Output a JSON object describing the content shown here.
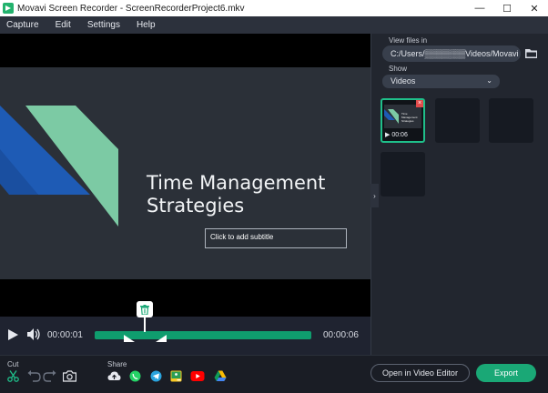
{
  "window": {
    "title": "Movavi Screen Recorder - ScreenRecorderProject6.mkv",
    "minimize": "—",
    "maximize": "☐",
    "close": "✕"
  },
  "menu": [
    "Capture",
    "Edit",
    "Settings",
    "Help"
  ],
  "preview": {
    "slide_title_line1": "Time Management",
    "slide_title_line2": "Strategies",
    "subtitle_placeholder": "Click to add subtitle"
  },
  "player": {
    "current_time": "00:00:01",
    "total_time": "00:00:06",
    "position": 0.23
  },
  "sidebar": {
    "view_files_label": "View files in",
    "path": "C:/Users/▒▒▒▒▒▒▒Videos/Movavi",
    "show_label": "Show",
    "show_value": "Videos",
    "thumbnails": [
      {
        "duration": "00:06",
        "caption": "Time Management Strategies",
        "active": true
      },
      {
        "duration": "",
        "active": false
      },
      {
        "duration": "",
        "active": false
      },
      {
        "duration": "",
        "active": false
      }
    ]
  },
  "bottom": {
    "cut_label": "Cut",
    "share_label": "Share",
    "open_editor": "Open in Video Editor",
    "export": "Export"
  },
  "colors": {
    "accent": "#1aa876",
    "track": "#0f9d6e",
    "background": "#1f2330"
  }
}
